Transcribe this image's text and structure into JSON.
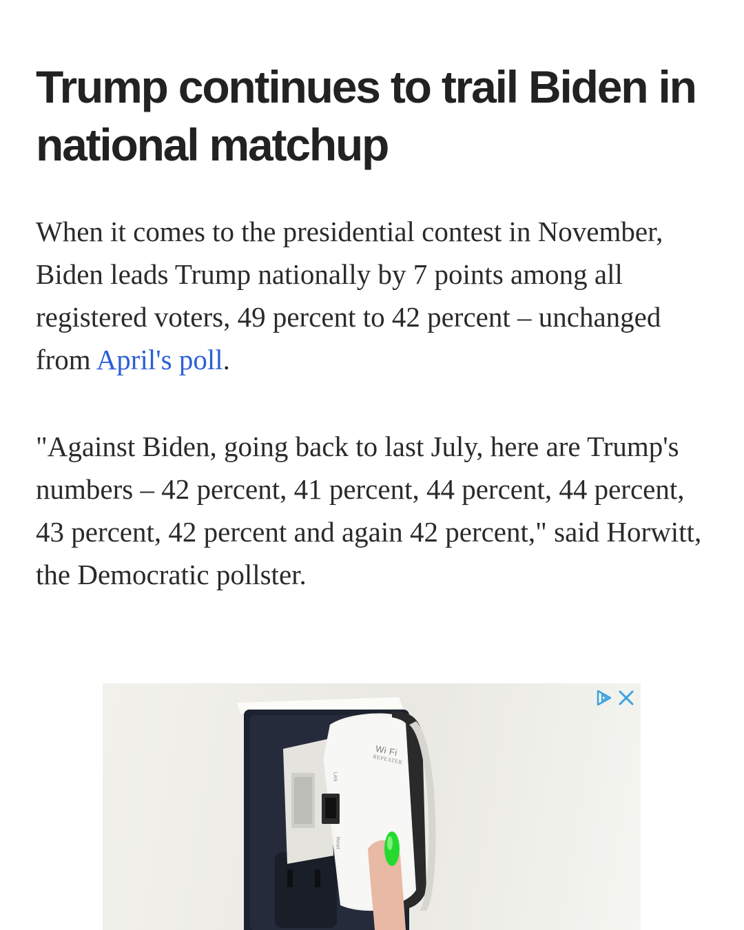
{
  "article": {
    "headline": "Trump continues to trail Biden in national matchup",
    "paragraph1": {
      "text_before_link": "When it comes to the presidential contest in November, Biden leads Trump nationally by 7 points among all registered voters, 49 percent to 42 percent – unchanged from ",
      "link_text": "April's poll",
      "text_after_link": "."
    },
    "paragraph2": "\"Against Biden, going back to last July, here are Trump's numbers – 42 percent, 41 percent, 44 percent, 44 percent, 43 percent, 42 percent and again 42 percent,\" said Horwitt, the Democratic pollster."
  },
  "ad": {
    "choices_icon": "adchoices-icon",
    "close_icon": "close-icon",
    "device_brand": "Wi Fi",
    "device_sub": "REPEATER",
    "device_lan": "LAN",
    "device_reset": "Reset",
    "accent_color": "#3ba3e0"
  },
  "colors": {
    "headline": "#222222",
    "body_text": "#2a2a2a",
    "link": "#2a5fd6"
  }
}
